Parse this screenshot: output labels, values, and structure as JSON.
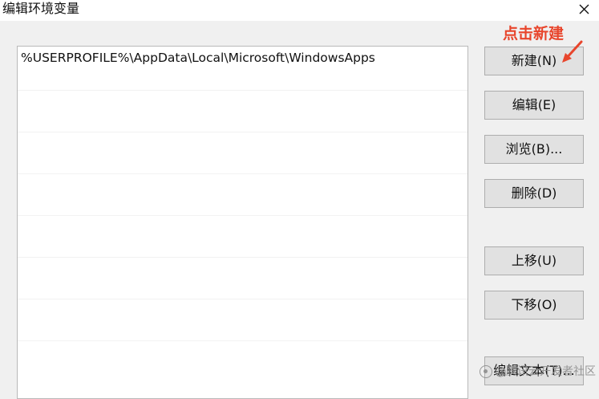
{
  "window": {
    "title": "编辑环境变量"
  },
  "path_list": {
    "items": [
      "%USERPROFILE%\\AppData\\Local\\Microsoft\\WindowsApps"
    ]
  },
  "buttons": {
    "new": "新建(N)",
    "edit": "编辑(E)",
    "browse": "浏览(B)...",
    "delete": "删除(D)",
    "move_up": "上移(U)",
    "move_down": "下移(O)",
    "edit_text": "编辑文本(T)..."
  },
  "annotation": {
    "text": "点击新建",
    "color": "#e8452c"
  },
  "watermark": {
    "text": "@腾讯云开发者社区"
  },
  "icons": {
    "close": "close-icon",
    "arrow": "annotation-arrow-icon",
    "watermark": "watermark-logo-icon"
  }
}
